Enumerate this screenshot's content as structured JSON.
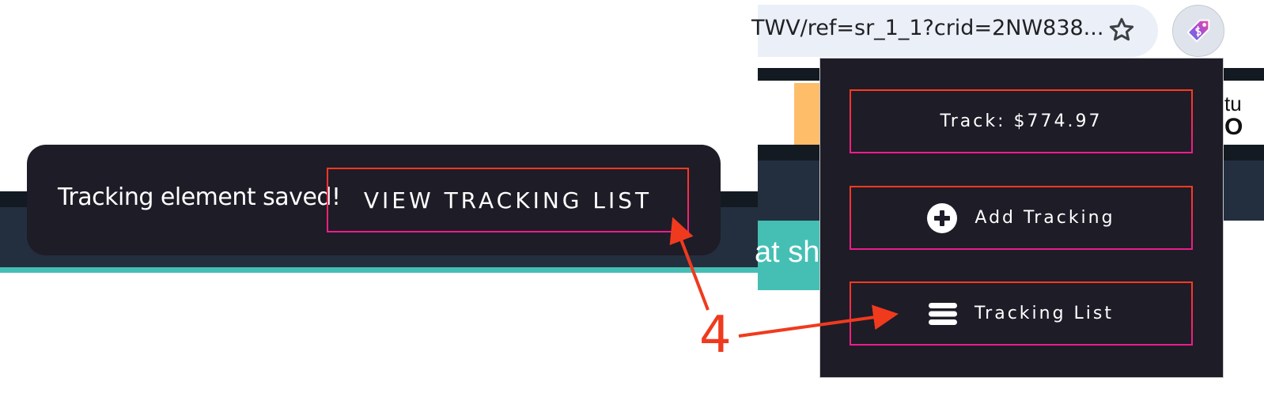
{
  "browser": {
    "url_fragment": "TWV/ref=sr_1_1?crid=2NW838...",
    "bookmark_icon": "star-outline-icon",
    "extension_icon": "price-tag-icon"
  },
  "toast": {
    "message": "Tracking element saved!",
    "button_label": "VIEW TRACKING LIST"
  },
  "popup": {
    "track_button": "Track: $774.97",
    "add_tracking_button": "Add Tracking",
    "tracking_list_button": "Tracking List"
  },
  "background_page": {
    "partial_text_teal": "at sh",
    "partial_text_right_line1": "tu",
    "partial_text_right_line2": "O"
  },
  "annotation": {
    "step_number": "4",
    "color": "#f03a1e"
  },
  "colors": {
    "popup_bg": "#1e1c27",
    "button_border_top": "#ff3a1e",
    "button_border_bottom": "#ee1c8c",
    "amazon_navy": "#232f3e",
    "amazon_teal": "#45bfb4"
  }
}
